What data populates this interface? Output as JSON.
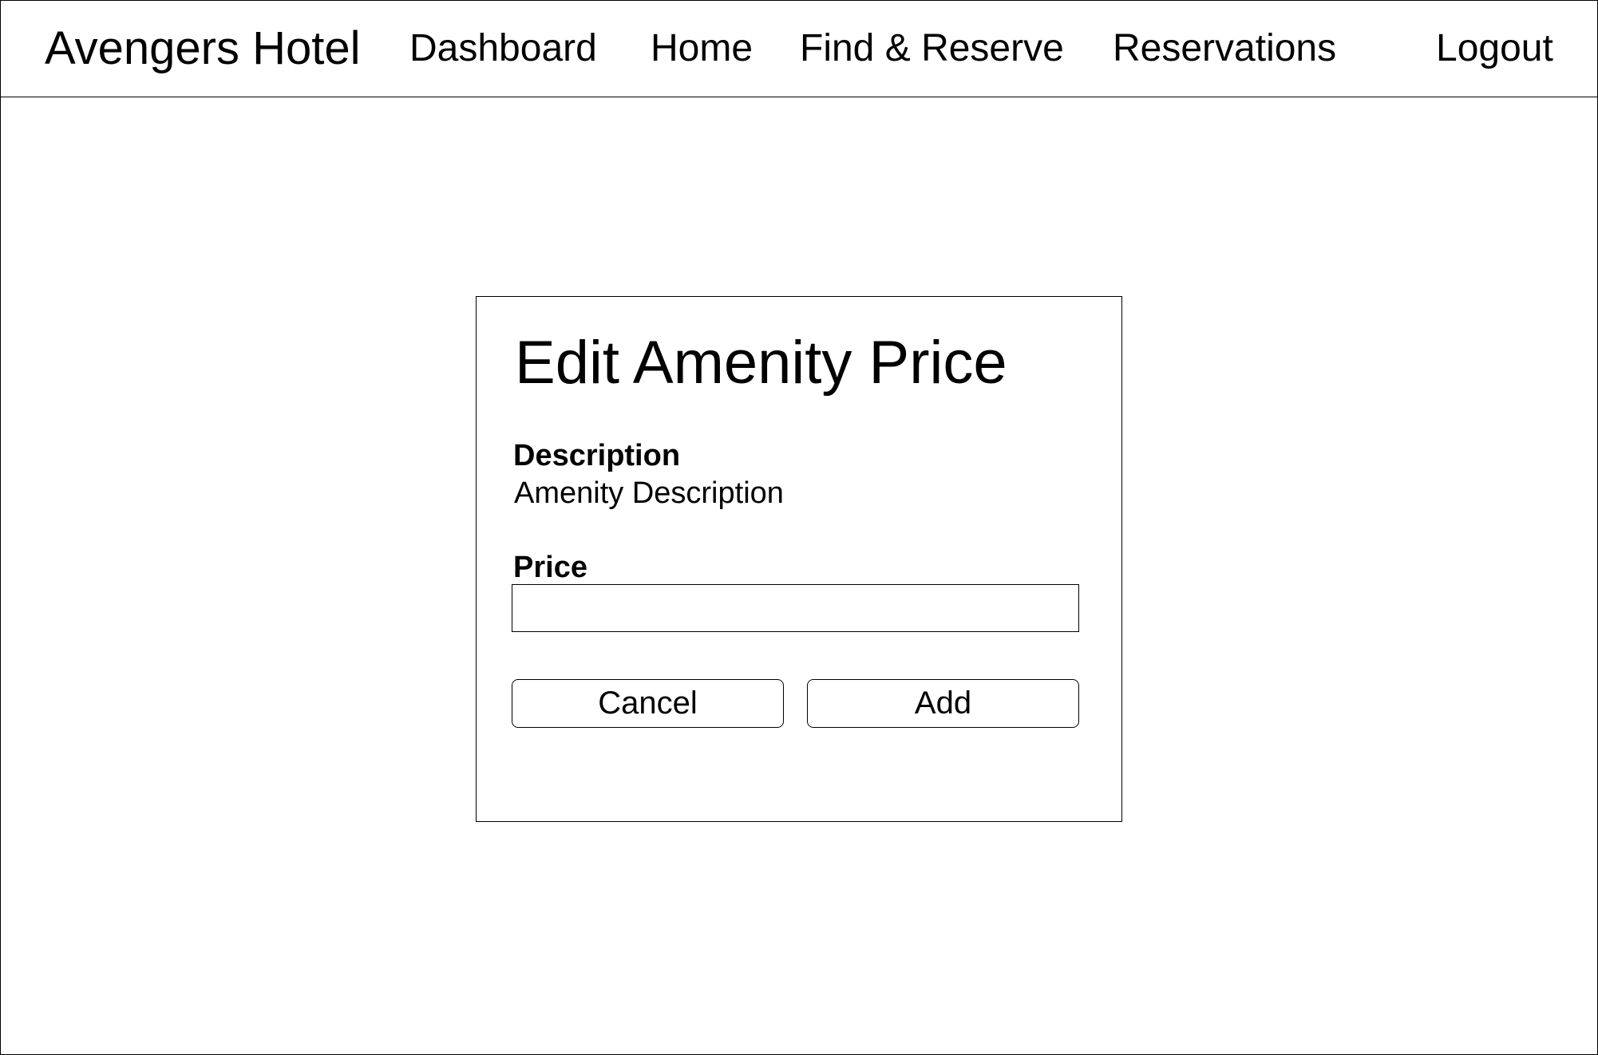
{
  "header": {
    "brand": "Avengers Hotel",
    "nav": {
      "dashboard": "Dashboard",
      "home": "Home",
      "find_reserve": "Find & Reserve",
      "reservations": "Reservations",
      "logout": "Logout"
    }
  },
  "dialog": {
    "title": "Edit Amenity Price",
    "description_label": "Description",
    "description_value": "Amenity Description",
    "price_label": "Price",
    "price_value": "",
    "cancel_label": "Cancel",
    "add_label": "Add"
  },
  "colors": {
    "border": "#000000",
    "background": "#ffffff",
    "text": "#000000"
  }
}
